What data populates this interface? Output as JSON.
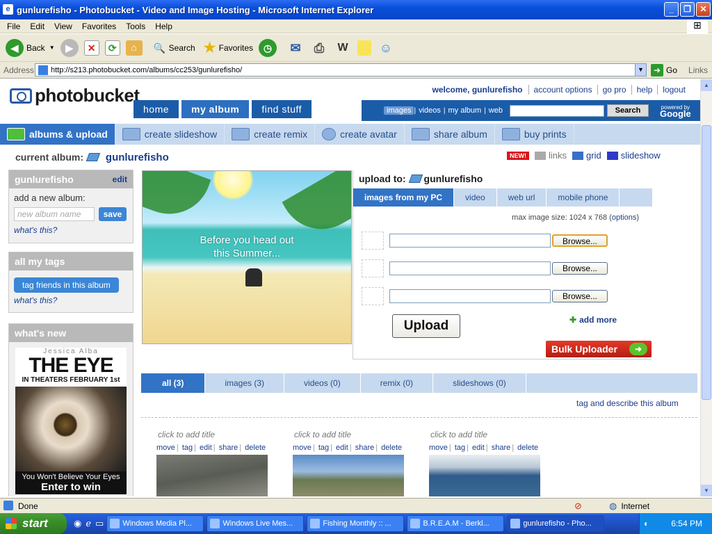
{
  "window": {
    "title": "gunlurefisho - Photobucket - Video and Image Hosting - Microsoft Internet Explorer",
    "controls": [
      "_",
      "❐",
      "✕"
    ]
  },
  "menu": [
    "File",
    "Edit",
    "View",
    "Favorites",
    "Tools",
    "Help"
  ],
  "toolbar": {
    "back": "Back",
    "search": "Search",
    "favorites": "Favorites"
  },
  "address": {
    "label": "Address",
    "url": "http://s213.photobucket.com/albums/cc253/gunlurefisho/",
    "go": "Go",
    "links": "Links"
  },
  "site": {
    "logo": "photobucket",
    "welcome": "welcome, gunlurefisho",
    "top_links": [
      "account options",
      "go pro",
      "help",
      "logout"
    ],
    "nav_tabs": [
      "home",
      "my album",
      "find stuff"
    ],
    "search_types": [
      "images",
      "videos",
      "my album",
      "web"
    ],
    "search_button": "Search",
    "powered_by": "powered by",
    "google": "Google",
    "subnav": [
      "albums & upload",
      "create slideshow",
      "create remix",
      "create avatar",
      "share album",
      "buy prints"
    ]
  },
  "current_album": {
    "label": "current album:",
    "name": "gunlurefisho"
  },
  "views": {
    "new": "NEW!",
    "links": "links",
    "grid": "grid",
    "slideshow": "slideshow"
  },
  "sidebar": {
    "album_box": {
      "title": "gunlurefisho",
      "edit": "edit",
      "add_label": "add a new album:",
      "placeholder": "new album name",
      "save": "save",
      "whats_this": "what's this?"
    },
    "tags_box": {
      "title": "all my tags",
      "button": "tag friends in this album",
      "whats_this": "what's this?"
    },
    "whats_new": {
      "title": "what's new"
    }
  },
  "ad": {
    "actor": "Jessica Alba",
    "title": "THE EYE",
    "release": "IN THEATERS FEBRUARY 1st",
    "tagline": "You Won't Believe Your Eyes",
    "cta": "Enter to win"
  },
  "banner": {
    "text1": "Before you head out",
    "text2": "this Summer..."
  },
  "upload": {
    "to_label": "upload to:",
    "album": "gunlurefisho",
    "tabs": [
      "images from my PC",
      "video",
      "web url",
      "mobile phone"
    ],
    "max_size": "max image size: 1024 x 768 (",
    "options": "options",
    "max_close": ")",
    "browse": "Browse...",
    "upload_button": "Upload",
    "add_more": "add more",
    "bulk": "Bulk Uploader"
  },
  "filters": [
    "all (3)",
    "images (3)",
    "videos (0)",
    "remix (0)",
    "slideshows (0)"
  ],
  "tag_describe": "tag and describe this album",
  "photos": [
    {
      "title": "click to add title",
      "actions": [
        "move",
        "tag",
        "edit",
        "share",
        "delete"
      ]
    },
    {
      "title": "click to add title",
      "actions": [
        "move",
        "tag",
        "edit",
        "share",
        "delete"
      ]
    },
    {
      "title": "click to add title",
      "actions": [
        "move",
        "tag",
        "edit",
        "share",
        "delete"
      ]
    }
  ],
  "status": {
    "text": "Done",
    "zone": "Internet"
  },
  "taskbar": {
    "start": "start",
    "tasks": [
      "Windows Media Pl...",
      "Windows Live Mes...",
      "Fishing Monthly :: ...",
      "B.R.E.A.M - Berkl...",
      "gunlurefisho - Pho..."
    ],
    "clock": "6:54 PM"
  },
  "colors": {
    "photobucket_blue": "#1b5ca8",
    "tab_active": "#3273c6",
    "subnav_bg": "#c7d9ef",
    "bulk_red": "#d8281a"
  }
}
